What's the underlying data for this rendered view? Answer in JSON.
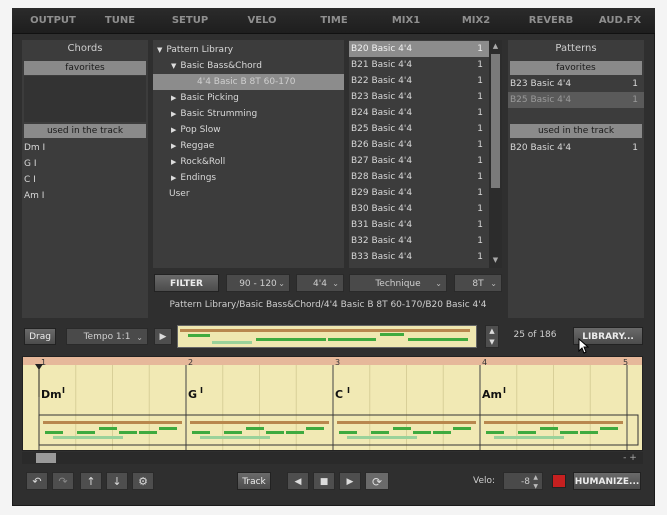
{
  "nav": [
    "OUTPUT",
    "TUNE",
    "SETUP",
    "VELO",
    "TIME",
    "MIX1",
    "MIX2",
    "REVERB",
    "AUD.FX"
  ],
  "chords_panel": {
    "title": "Chords",
    "favorites_label": "favorites",
    "used_label": "used in the track",
    "used": [
      "Dm I",
      "G I",
      "C I",
      "Am I"
    ]
  },
  "library": {
    "root": "Pattern Library",
    "items": [
      {
        "label": "Basic Bass&Chord",
        "expanded": true
      },
      {
        "label": "4'4 Basic B 8T 60-170",
        "child": true,
        "selected": true
      },
      {
        "label": "Basic Picking"
      },
      {
        "label": "Basic Strumming"
      },
      {
        "label": "Pop Slow"
      },
      {
        "label": "Reggae"
      },
      {
        "label": "Rock&Roll"
      },
      {
        "label": "Endings"
      }
    ],
    "user": "User"
  },
  "pattern_list": [
    {
      "name": "B20 Basic 4'4",
      "count": "1"
    },
    {
      "name": "B21 Basic 4'4",
      "count": "1"
    },
    {
      "name": "B22 Basic 4'4",
      "count": "1"
    },
    {
      "name": "B23 Basic 4'4",
      "count": "1"
    },
    {
      "name": "B24 Basic 4'4",
      "count": "1"
    },
    {
      "name": "B25 Basic 4'4",
      "count": "1"
    },
    {
      "name": "B26 Basic 4'4",
      "count": "1"
    },
    {
      "name": "B27 Basic 4'4",
      "count": "1"
    },
    {
      "name": "B28 Basic 4'4",
      "count": "1"
    },
    {
      "name": "B29 Basic 4'4",
      "count": "1"
    },
    {
      "name": "B30 Basic 4'4",
      "count": "1"
    },
    {
      "name": "B31 Basic 4'4",
      "count": "1"
    },
    {
      "name": "B32 Basic 4'4",
      "count": "1"
    },
    {
      "name": "B33 Basic 4'4",
      "count": "1"
    }
  ],
  "patterns_panel": {
    "title": "Patterns",
    "favorites_label": "favorites",
    "favorites": [
      {
        "name": "B23 Basic 4'4",
        "count": "1"
      },
      {
        "name": "B25 Basic 4'4",
        "count": "1"
      }
    ],
    "used_label": "used in the track",
    "used": [
      {
        "name": "B20 Basic 4'4",
        "count": "1"
      }
    ]
  },
  "filter": {
    "button": "FILTER",
    "tempo": "90 - 120",
    "meter": "4'4",
    "technique": "Technique",
    "subdivision": "8T"
  },
  "path": "Pattern Library/Basic Bass&Chord/4'4 Basic B 8T 60-170/B20 Basic 4'4",
  "transport_row": {
    "drag": "Drag",
    "tempo": "Tempo 1:1",
    "count": "25 of 186",
    "library": "LIBRARY..."
  },
  "track": {
    "bar_numbers": [
      "1",
      "2",
      "3",
      "4",
      "5"
    ],
    "chords": [
      {
        "root": "Dm",
        "mark": "I"
      },
      {
        "root": "G",
        "mark": "I"
      },
      {
        "root": "C",
        "mark": "I"
      },
      {
        "root": "Am",
        "mark": "I"
      }
    ]
  },
  "bottom": {
    "track_btn": "Track",
    "velo_label": "Velo:",
    "velo_value": "-8",
    "humanize": "HUMANIZE..."
  },
  "colors": {
    "panel": "#3a3a3a",
    "track_bg": "#f1e9b4",
    "note_green": "#3faa3f",
    "note_brown": "#b8874e",
    "accent_red": "#c62020"
  }
}
